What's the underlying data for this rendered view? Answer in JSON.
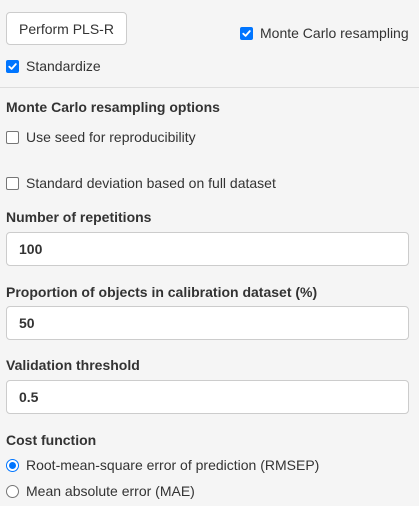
{
  "actions": {
    "perform_label": "Perform PLS-R"
  },
  "options": {
    "monte_carlo": {
      "label": "Monte Carlo resampling",
      "checked": true
    },
    "standardize": {
      "label": "Standardize",
      "checked": true
    }
  },
  "mc_options": {
    "title": "Monte Carlo resampling options",
    "use_seed": {
      "label": "Use seed for reproducibility",
      "checked": false
    },
    "std_full": {
      "label": "Standard deviation based on full dataset",
      "checked": false
    },
    "repetitions": {
      "label": "Number of repetitions",
      "value": "100"
    },
    "proportion": {
      "label": "Proportion of objects in calibration dataset (%)",
      "value": "50"
    },
    "threshold": {
      "label": "Validation threshold",
      "value": "0.5"
    },
    "cost_function": {
      "title": "Cost function",
      "options": [
        {
          "label": "Root-mean-square error of prediction (RMSEP)",
          "selected": true
        },
        {
          "label": "Mean absolute error (MAE)",
          "selected": false
        }
      ]
    }
  },
  "colors": {
    "accent": "#0075ff",
    "background": "#f5f5f5",
    "border": "#cccccc",
    "text": "#333333"
  }
}
